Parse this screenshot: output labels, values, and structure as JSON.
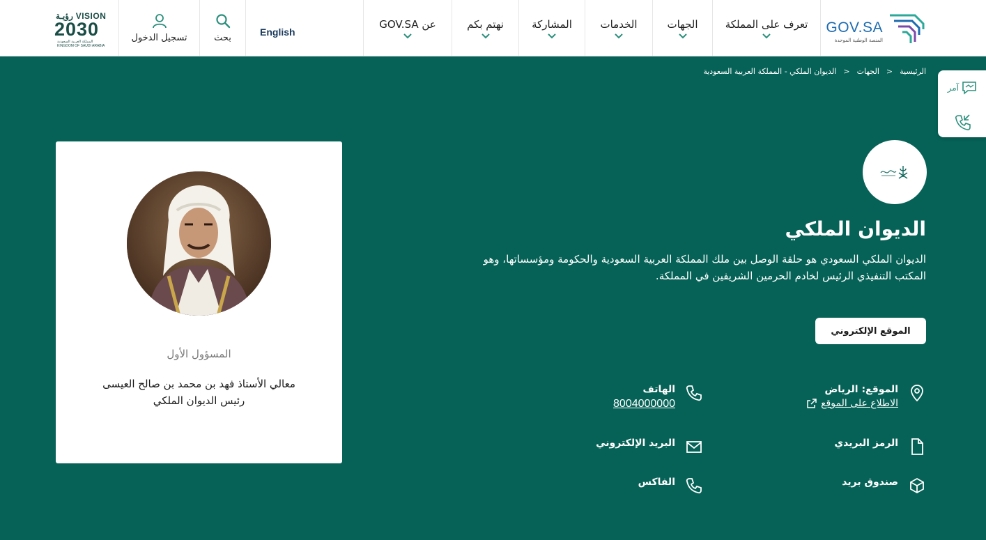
{
  "header": {
    "logo": {
      "brand": "GOV.SA",
      "tagline": "المنصة الوطنية الموحدة"
    },
    "nav": [
      {
        "label": "تعرف على المملكة"
      },
      {
        "label": "الجهات"
      },
      {
        "label": "الخدمات"
      },
      {
        "label": "المشاركة"
      },
      {
        "label": "نهتم بكم"
      },
      {
        "label": "عن GOV.SA"
      }
    ],
    "language": "English",
    "search_label": "بحث",
    "login_label": "تسجيل الدخول",
    "vision": {
      "line1": "VISION رؤيـة",
      "line2": "2030",
      "line3": "المملكة العربية السعودية",
      "line4": "KINGDOM OF SAUDI ARABIA"
    }
  },
  "breadcrumb": [
    "الرئيسية",
    "الجهات",
    "الديوان الملكي - المملكة العربية السعودية"
  ],
  "side_widget": {
    "amr_label": "آمر"
  },
  "entity": {
    "name": "الديوان الملكي",
    "description": "الديوان الملكي السعودي هو حلقة الوصل بين ملك المملكة العربية السعودية والحكومة ومؤسساتها، وهو المكتب التنفيذي الرئيس لخادم الحرمين الشريفين في المملكة.",
    "website_button": "الموقع الإلكتروني",
    "location": {
      "title": "الموقع: الرياض",
      "link": "الاطلاع على الموقع"
    },
    "phone": {
      "title": "الهاتف",
      "value": "8004000000"
    },
    "postal_code": {
      "title": "الرمز البريدي"
    },
    "email": {
      "title": "البريد الإلكتروني"
    },
    "po_box": {
      "title": "صندوق بريد"
    },
    "fax": {
      "title": "الفاكس"
    }
  },
  "official": {
    "role": "المسؤول الأول",
    "name": "معالي الأستاذ فهد بن محمد بن صالح العيسى",
    "title": "رئيس الديوان الملكي"
  }
}
